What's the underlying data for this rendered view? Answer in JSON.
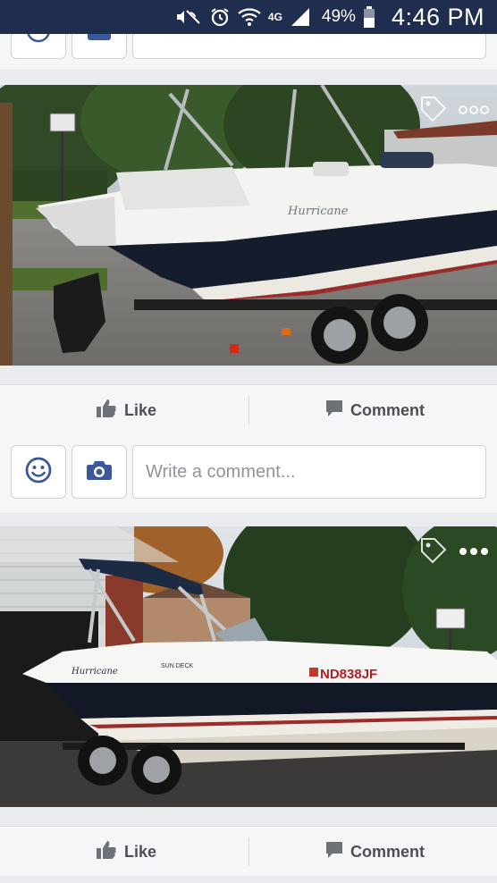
{
  "status_bar": {
    "network": "4G",
    "battery": "49%",
    "time": "4:46 PM"
  },
  "composer": {
    "placeholder": "Write a comment..."
  },
  "posts": [
    {
      "photo_text": "Hurricane",
      "actions": {
        "like": "Like",
        "comment": "Comment"
      }
    },
    {
      "photo_text": "Hurricane",
      "sun_deck_text": "SUN DECK",
      "registration": "ND838JF",
      "actions": {
        "like": "Like",
        "comment": "Comment"
      }
    }
  ],
  "colors": {
    "status_bar": "#1f2d4e",
    "fb_icon": "#3b5998",
    "background": "#e9ebee"
  },
  "icons": [
    "silent-icon",
    "alarm-icon",
    "wifi-icon",
    "signal-icon",
    "battery-icon",
    "smiley-icon",
    "camera-icon",
    "tag-icon",
    "more-icon",
    "like-icon",
    "comment-icon"
  ]
}
